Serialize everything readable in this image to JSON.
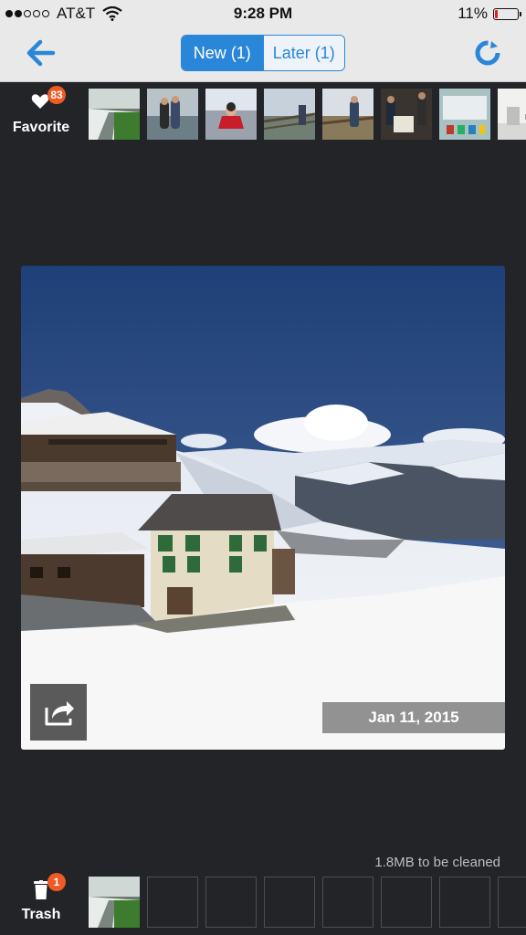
{
  "status": {
    "carrier": "AT&T",
    "time": "9:28 PM",
    "battery": "11%",
    "battery_level": 0.11,
    "signal_bars_filled": 2,
    "signal_bars_total": 5
  },
  "nav": {
    "tab_new": "New (1)",
    "tab_later": "Later (1)",
    "active_tab": "new",
    "back_icon": "back-arrow-icon",
    "refresh_icon": "refresh-icon"
  },
  "favorites": {
    "label": "Favorite",
    "count": "83",
    "icon": "heart-icon",
    "thumbnails": [
      "snowy-path",
      "couple-beach",
      "child-on-rocks",
      "railing-view",
      "man-at-fence",
      "group-indoor",
      "museum-display",
      "white-room"
    ]
  },
  "photo": {
    "date": "Jan 11, 2015",
    "share_icon": "share-icon",
    "subject": "snowy-alpine-chalets"
  },
  "trash": {
    "label": "Trash",
    "count": "1",
    "icon": "trash-icon",
    "clean_text": "1.8MB to be cleaned",
    "filled_slots": 1,
    "total_slots": 8
  },
  "colors": {
    "accent": "#2a86d8",
    "badge": "#f05a24",
    "background": "#232428",
    "bar": "#e9e9ea"
  }
}
